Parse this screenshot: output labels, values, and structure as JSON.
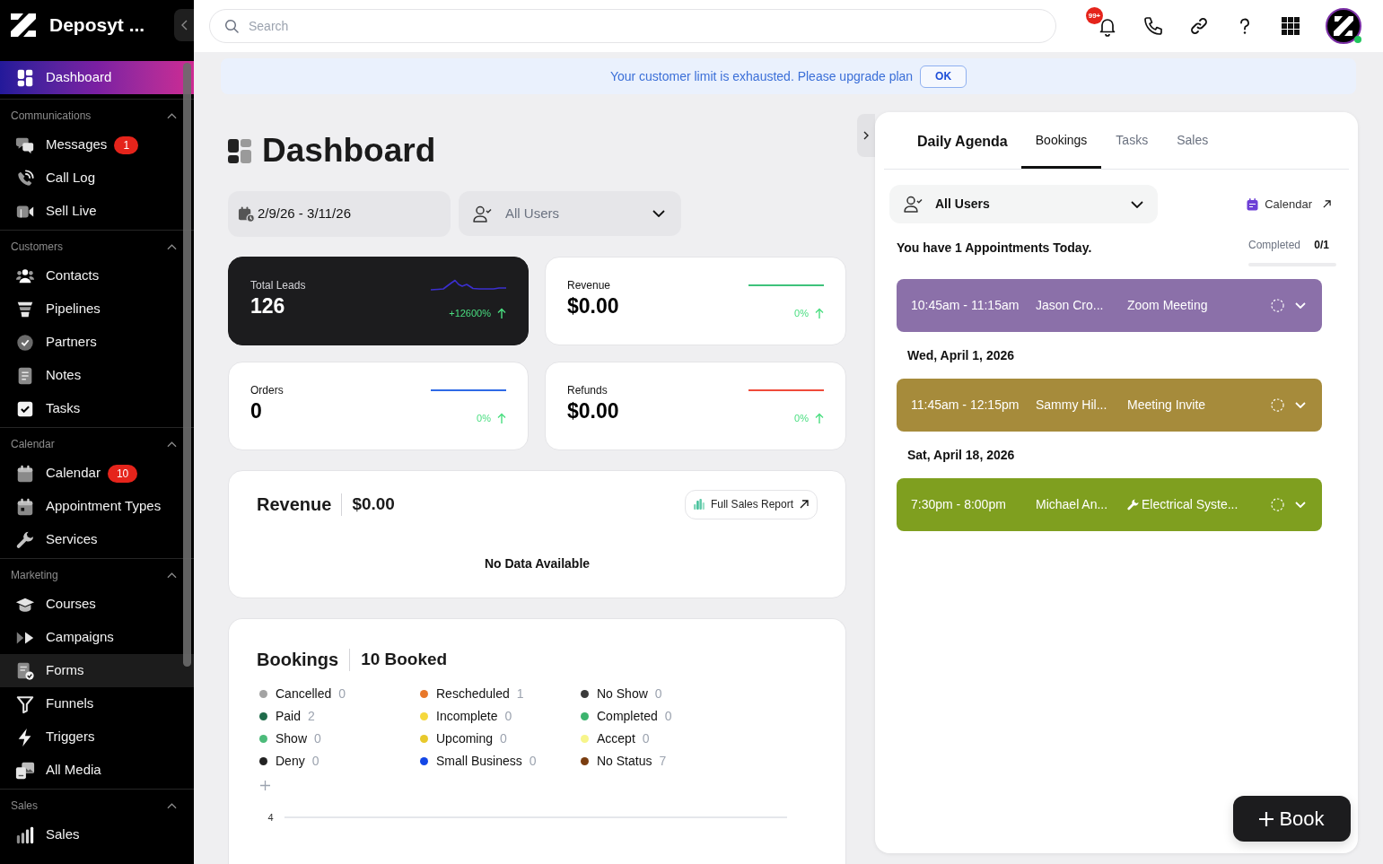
{
  "sidebar": {
    "brand": "Deposyt ...",
    "nav": [
      {
        "label": "Dashboard",
        "selected": true
      }
    ],
    "sections": [
      {
        "title": "Communications",
        "expanded": true,
        "items": [
          {
            "label": "Messages",
            "badge": "1",
            "selected": false,
            "hovered": false
          },
          {
            "label": "Call Log",
            "selected": false,
            "hovered": false
          },
          {
            "label": "Sell Live",
            "selected": false,
            "hovered": false
          }
        ]
      },
      {
        "title": "Customers",
        "expanded": true,
        "items": [
          {
            "label": "Contacts",
            "selected": false,
            "hovered": false
          },
          {
            "label": "Pipelines",
            "selected": false,
            "hovered": false
          },
          {
            "label": "Partners",
            "selected": false,
            "hovered": false
          },
          {
            "label": "Notes",
            "selected": false,
            "hovered": false
          },
          {
            "label": "Tasks",
            "selected": false,
            "hovered": false
          }
        ]
      },
      {
        "title": "Calendar",
        "expanded": true,
        "items": [
          {
            "label": "Calendar",
            "badge": "10",
            "selected": false,
            "hovered": false
          },
          {
            "label": "Appointment Types",
            "selected": false,
            "hovered": false
          },
          {
            "label": "Services",
            "selected": false,
            "hovered": false
          }
        ]
      },
      {
        "title": "Marketing",
        "expanded": true,
        "items": [
          {
            "label": "Courses",
            "selected": false,
            "hovered": false
          },
          {
            "label": "Campaigns",
            "selected": false,
            "hovered": false
          },
          {
            "label": "Forms",
            "selected": false,
            "hovered": true
          },
          {
            "label": "Funnels",
            "selected": false,
            "hovered": false
          },
          {
            "label": "Triggers",
            "selected": false,
            "hovered": false
          },
          {
            "label": "All Media",
            "selected": false,
            "hovered": false
          }
        ]
      },
      {
        "title": "Sales",
        "expanded": true,
        "items": [
          {
            "label": "Sales",
            "selected": false,
            "hovered": false
          }
        ]
      }
    ]
  },
  "top_bar": {
    "search": {
      "placeholder": "Search"
    },
    "notification_badge": "99+"
  },
  "banner": {
    "message": "Your customer limit is exhausted. Please upgrade plan",
    "button": "OK"
  },
  "dashboard": {
    "title": "Dashboard",
    "date_range": "2/9/26 - 3/11/26",
    "user_filter": {
      "placeholder": "All Users"
    },
    "metrics": [
      {
        "label": "Total Leads",
        "value": "126",
        "change": "+12600%",
        "selected": true,
        "kind": "wave",
        "color": "#3b2fcf"
      },
      {
        "label": "Revenue",
        "value": "$0.00",
        "change": "0%",
        "selected": false,
        "kind": "flat",
        "color": "#3ec27a"
      },
      {
        "label": "Orders",
        "value": "0",
        "change": "0%",
        "selected": false,
        "kind": "flat",
        "color": "#2f6ae6"
      },
      {
        "label": "Refunds",
        "value": "$0.00",
        "change": "0%",
        "selected": false,
        "kind": "flat",
        "color": "#ef4a3a"
      }
    ],
    "revenue": {
      "title": "Revenue",
      "total": "$0.00",
      "button": "Full Sales Report",
      "empty_message": "No Data Available"
    },
    "bookings": {
      "title": "Bookings",
      "total": "10 Booked",
      "statuses": [
        {
          "label": "Cancelled",
          "count": "0",
          "color": "#a3a3a3"
        },
        {
          "label": "Rescheduled",
          "count": "1",
          "color": "#e8782a"
        },
        {
          "label": "No Show",
          "count": "0",
          "color": "#3a3a3a"
        },
        {
          "label": "Paid",
          "count": "2",
          "color": "#1f6b4a"
        },
        {
          "label": "Incomplete",
          "count": "0",
          "color": "#f5d83d"
        },
        {
          "label": "Completed",
          "count": "0",
          "color": "#3cb46e"
        },
        {
          "label": "Show",
          "count": "0",
          "color": "#4cbb7a"
        },
        {
          "label": "Upcoming",
          "count": "0",
          "color": "#e8c92c"
        },
        {
          "label": "Accept",
          "count": "0",
          "color": "#f7f58a"
        },
        {
          "label": "Deny",
          "count": "0",
          "color": "#222222"
        },
        {
          "label": "Small Business",
          "count": "0",
          "color": "#1447e6"
        },
        {
          "label": "No Status",
          "count": "7",
          "color": "#7a3d10"
        }
      ],
      "axis_label": "4"
    }
  },
  "agenda_panel": {
    "title": "Daily Agenda",
    "tabs": [
      {
        "label": "Bookings",
        "selected": true
      },
      {
        "label": "Tasks",
        "selected": false
      },
      {
        "label": "Sales",
        "selected": false
      }
    ],
    "user_filter": {
      "value": "All Users"
    },
    "calendar_link": "Calendar",
    "summary": "You have 1 Appointments Today.",
    "completed": {
      "label": "Completed",
      "count": "0/1",
      "level": 0
    },
    "groups": [
      {
        "appointments": [
          {
            "time": "10:45am - 11:15am",
            "name": "Jason Cro...",
            "title": "Zoom Meeting",
            "kind": "meeting",
            "color": "#8b70a9",
            "completed": false,
            "expanded": false
          }
        ]
      },
      {
        "date": "Wed, April 1, 2026",
        "appointments": [
          {
            "time": "11:45am - 12:15pm",
            "name": "Sammy Hil...",
            "title": "Meeting Invite",
            "kind": "meeting",
            "color": "#a68b3b",
            "completed": false,
            "expanded": false
          }
        ]
      },
      {
        "date": "Sat, April 18, 2026",
        "appointments": [
          {
            "time": "7:30pm - 8:00pm",
            "name": "Michael An...",
            "title": "Electrical Syste...",
            "kind": "service",
            "color": "#7f9f1f",
            "completed": false,
            "expanded": false
          }
        ]
      }
    ],
    "book_button": "Book"
  }
}
